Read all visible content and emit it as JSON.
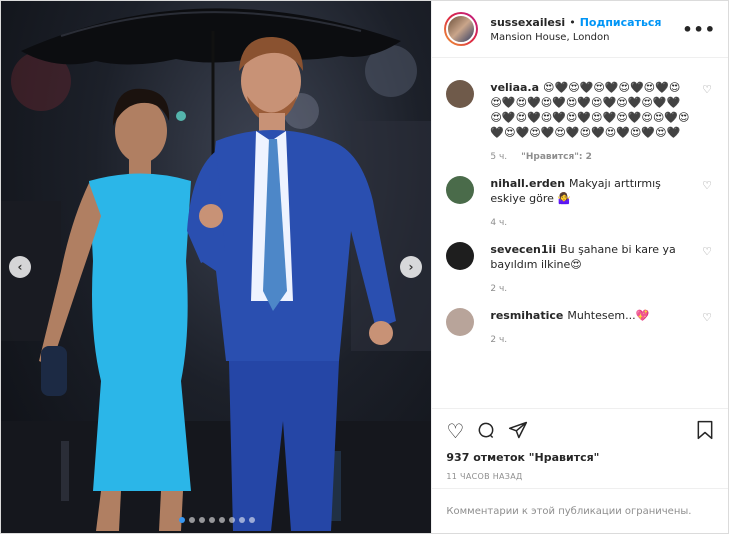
{
  "post": {
    "username": "sussexailesi",
    "separator": "•",
    "follow_label": "Подписаться",
    "location": "Mansion House, London",
    "more_label": "•••"
  },
  "photo": {
    "prev_label": "‹",
    "next_label": "›",
    "slides_total": 8,
    "active_slide": 0
  },
  "comments": [
    {
      "username": "veliaa.a",
      "text": "😍🖤😍🖤😍🖤😍🖤😍🖤😍😍🖤😍🖤😍🖤😍🖤😍🖤😍🖤😍🖤🖤😍🖤😍🖤😍🖤😍🖤😍🖤😍🖤😍😍🖤😍🖤😍🖤😍🖤😍🖤😍🖤😍🖤😍🖤😍🖤",
      "time": "5 ч.",
      "likes": "\"Нравится\": 2",
      "avatar_color": "#6f5a4a"
    },
    {
      "username": "nihall.erden",
      "text": "Makyajı arttırmış eskiye göre 🤷‍♀️",
      "time": "4 ч.",
      "likes": "",
      "avatar_color": "#4a6b4a"
    },
    {
      "username": "sevecen1ii",
      "text": "Bu şahane bi kare ya bayıldım ilkine😍",
      "time": "2 ч.",
      "likes": "",
      "avatar_color": "#1e1e1e"
    },
    {
      "username": "resmihatice",
      "text": "Muhtesem...💖",
      "time": "2 ч.",
      "likes": "",
      "avatar_color": "#b8a49a"
    }
  ],
  "actions": {
    "like_icon": "heart-icon",
    "comment_icon": "comment-icon",
    "share_icon": "share-icon",
    "save_icon": "bookmark-icon",
    "likes_count": "937 отметок \"Нравится\"",
    "time_ago": "11 ЧАСОВ НАЗАД",
    "comments_disabled": "Комментарии к этой публикации ограничены."
  },
  "colors": {
    "accent": "#0095f6",
    "dress": "#2bb6e8",
    "suit": "#2a4fb0"
  }
}
